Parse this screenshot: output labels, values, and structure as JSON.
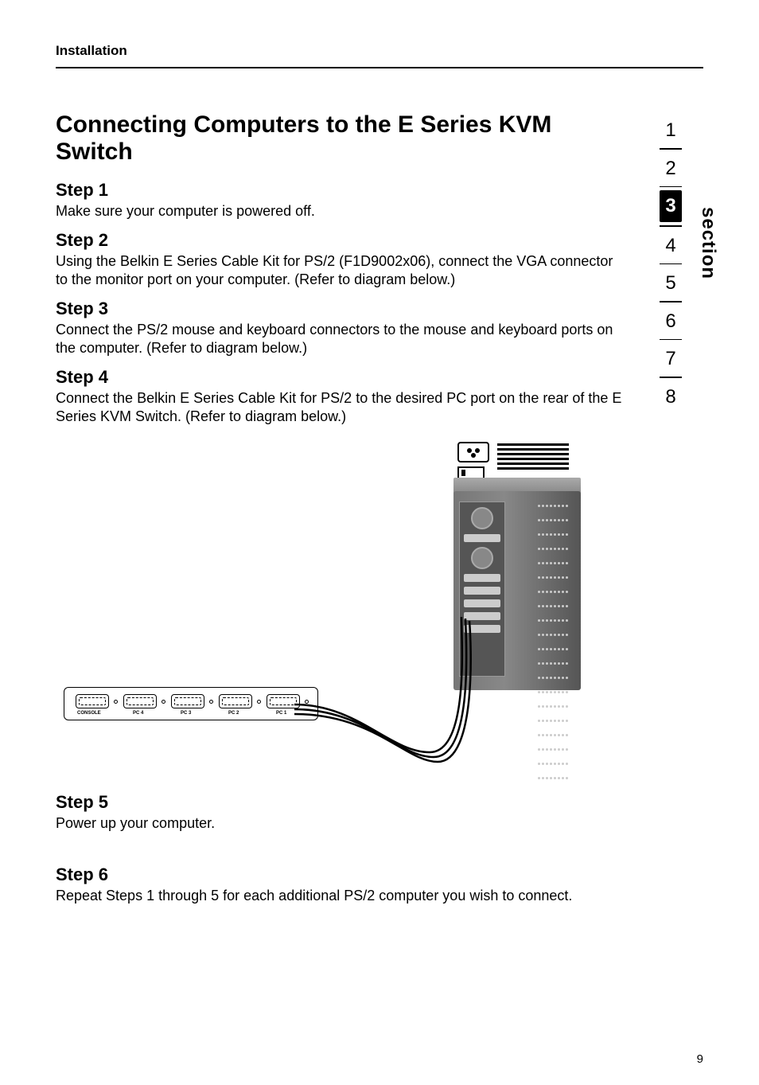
{
  "header": {
    "section_label": "Installation"
  },
  "title": "Connecting Computers to the E Series KVM Switch",
  "steps": {
    "s1": {
      "title": "Step 1",
      "body": "Make sure your computer is powered off."
    },
    "s2": {
      "title": "Step 2",
      "body": "Using the Belkin E Series Cable Kit for PS/2 (F1D9002x06), connect the VGA connector to the monitor port on your computer. (Refer to diagram below.)"
    },
    "s3": {
      "title": "Step 3",
      "body": "Connect the PS/2 mouse and keyboard connectors to the mouse and keyboard ports on the computer. (Refer to diagram below.)"
    },
    "s4": {
      "title": "Step 4",
      "body": "Connect the Belkin E Series Cable Kit for PS/2 to the desired PC port on the rear of the E Series KVM Switch. (Refer to diagram below.)"
    },
    "s5": {
      "title": "Step 5",
      "body": "Power up your computer."
    },
    "s6": {
      "title": "Step 6",
      "body": "Repeat Steps 1 through 5 for each additional PS/2 computer you wish to connect."
    }
  },
  "kvm_ports": {
    "console": "CONSOLE",
    "p4": "PC 4",
    "p3": "PC 3",
    "p2": "PC 2",
    "p1": "PC 1"
  },
  "sidebar": {
    "label": "section",
    "items": [
      "1",
      "2",
      "3",
      "4",
      "5",
      "6",
      "7",
      "8"
    ],
    "active_index": 2
  },
  "page_number": "9"
}
